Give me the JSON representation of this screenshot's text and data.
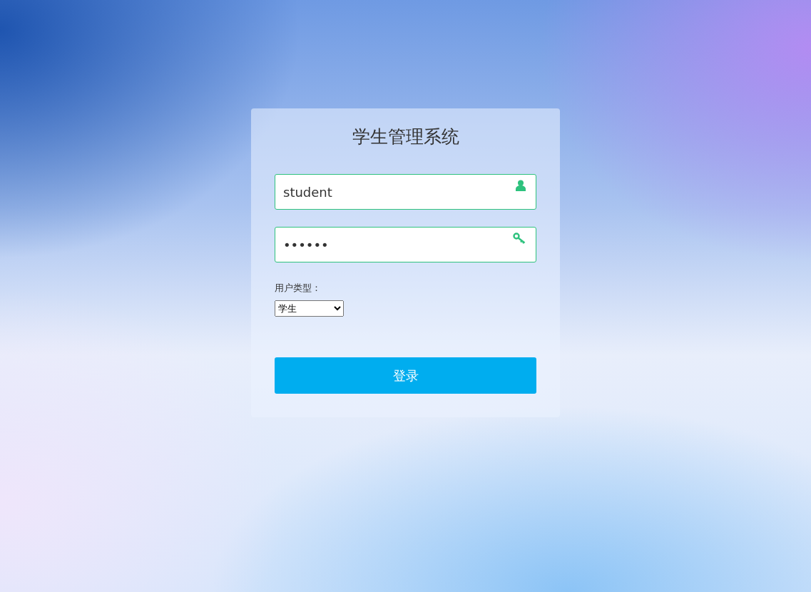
{
  "title": "学生管理系统",
  "username": {
    "value": "student"
  },
  "password": {
    "value": "••••••"
  },
  "user_type": {
    "label": "用户类型：",
    "value": "学生"
  },
  "login_button": "登录"
}
